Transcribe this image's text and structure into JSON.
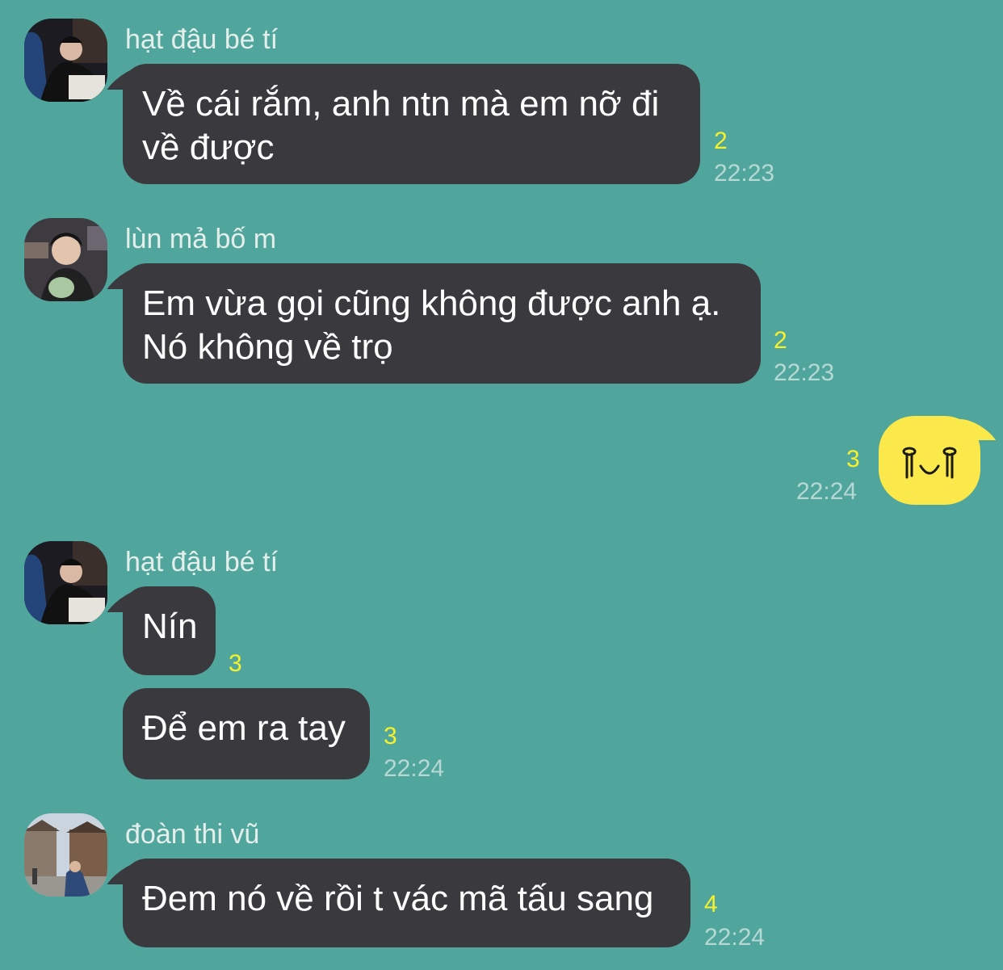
{
  "messages": [
    {
      "sender": "hạt đậu bé tí",
      "lines": [
        "Về cái rắm, anh ntn mà em nỡ đi",
        "về được"
      ],
      "count": "2",
      "time": "22:23"
    },
    {
      "sender": "lùn mả bố m",
      "lines": [
        "Em vừa gọi cũng không được anh ạ.",
        "Nó không về trọ"
      ],
      "count": "2",
      "time": "22:23"
    },
    {
      "mine": true,
      "sticker": "smiley-sticker-icon",
      "count": "3",
      "time": "22:24"
    },
    {
      "sender": "hạt đậu bé tí",
      "text": "Nín",
      "count": "3"
    },
    {
      "text": "Để em ra tay",
      "count": "3",
      "time": "22:24"
    },
    {
      "sender": "đoàn thi vũ",
      "text": "Đem nó về rồi t vác mã tấu sang",
      "count": "4",
      "time": "22:24"
    }
  ],
  "colors": {
    "background": "#50a59c",
    "incoming_bubble": "#3a3a3e",
    "outgoing_bubble": "#fbe94b",
    "unread_count": "#f7f12c"
  }
}
